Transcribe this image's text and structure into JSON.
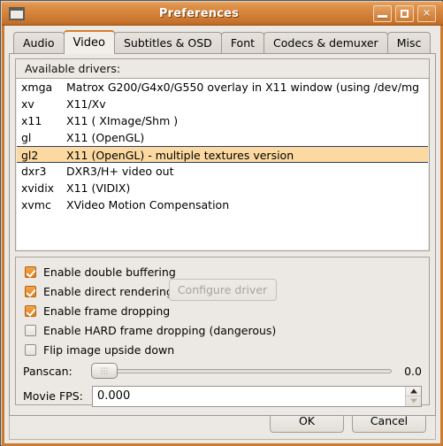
{
  "window": {
    "title": "Preferences",
    "icon": "window-icon",
    "buttons": {
      "minimize": "minimize-icon",
      "maximize": "maximize-icon",
      "close": "close-icon",
      "close_glyph": "✕"
    },
    "accent_color": "#d4812f",
    "titlebar_color": "#d3813a"
  },
  "tabs": [
    {
      "label": "Audio",
      "active": false
    },
    {
      "label": "Video",
      "active": true
    },
    {
      "label": "Subtitles & OSD",
      "active": false
    },
    {
      "label": "Font",
      "active": false
    },
    {
      "label": "Codecs & demuxer",
      "active": false
    },
    {
      "label": "Misc",
      "active": false
    }
  ],
  "drivers": {
    "frame_label": "Available drivers:",
    "selected_index": 4,
    "selection_color": "#fcd9a0",
    "rows": [
      {
        "name": "xmga",
        "description": "Matrox G200/G4x0/G550 overlay in X11 window (using /dev/mg"
      },
      {
        "name": "xv",
        "description": "X11/Xv"
      },
      {
        "name": "x11",
        "description": "X11 ( XImage/Shm )"
      },
      {
        "name": "gl",
        "description": "X11 (OpenGL)"
      },
      {
        "name": "gl2",
        "description": "X11 (OpenGL) - multiple textures version"
      },
      {
        "name": "dxr3",
        "description": "DXR3/H+ video out"
      },
      {
        "name": "xvidix",
        "description": "X11 (VIDIX)"
      },
      {
        "name": "xvmc",
        "description": "XVideo Motion Compensation"
      }
    ],
    "configure_button": {
      "label": "Configure driver",
      "enabled": false
    }
  },
  "options": {
    "checkboxes": [
      {
        "label": "Enable double buffering",
        "checked": true
      },
      {
        "label": "Enable direct rendering",
        "checked": true
      },
      {
        "label": "Enable frame dropping",
        "checked": true
      },
      {
        "label": "Enable HARD frame dropping (dangerous)",
        "checked": false
      },
      {
        "label": "Flip image upside down",
        "checked": false
      }
    ],
    "panscan": {
      "label": "Panscan:",
      "value": "0.0",
      "position_percent": 0
    },
    "movie_fps": {
      "label": "Movie FPS:",
      "value": "0.000",
      "placeholder": "0.000"
    }
  },
  "actions": {
    "ok": "OK",
    "cancel": "Cancel"
  }
}
